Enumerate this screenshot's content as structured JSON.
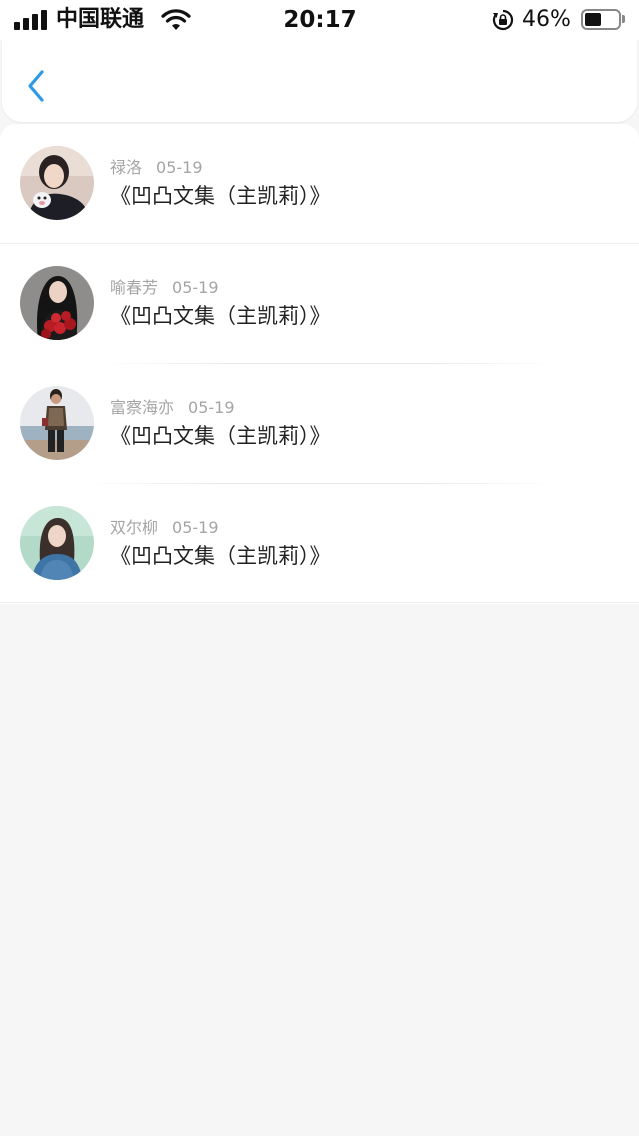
{
  "status_bar": {
    "carrier": "中国联通",
    "time": "20:17",
    "battery_percent": "46%",
    "battery_level": 0.46,
    "icons": [
      "signal-icon",
      "wifi-icon",
      "rotation-lock-icon",
      "battery-icon"
    ]
  },
  "nav": {
    "back_icon": "chevron-left-icon",
    "accent_color": "#2c9ae6"
  },
  "items": [
    {
      "name": "禄洛",
      "date": "05-19",
      "title": "《凹凸文集（主凯莉）》"
    },
    {
      "name": "喻春芳",
      "date": "05-19",
      "title": "《凹凸文集（主凯莉）》"
    },
    {
      "name": "富察海亦",
      "date": "05-19",
      "title": "《凹凸文集（主凯莉）》"
    },
    {
      "name": "双尔柳",
      "date": "05-19",
      "title": "《凹凸文集（主凯莉）》"
    }
  ]
}
